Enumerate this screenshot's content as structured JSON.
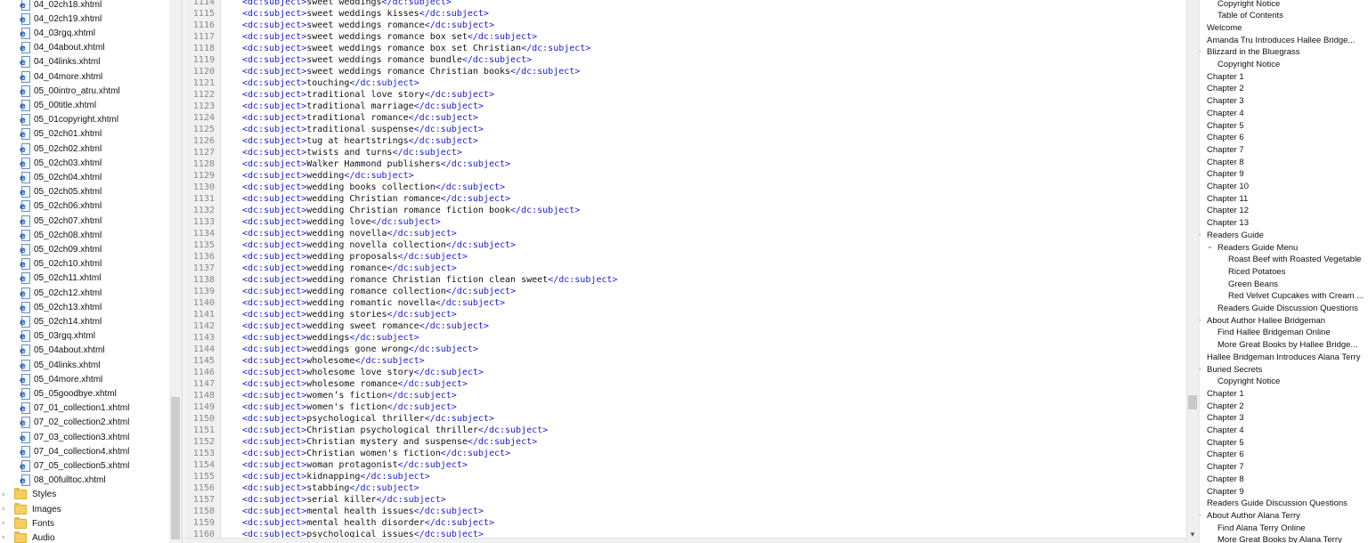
{
  "file_tree": {
    "files": [
      "04_02ch18.xhtml",
      "04_02ch19.xhtml",
      "04_03rgq.xhtml",
      "04_04about.xhtml",
      "04_04links.xhtml",
      "04_04more.xhtml",
      "05_00intro_atru.xhtml",
      "05_00title.xhtml",
      "05_01copyright.xhtml",
      "05_02ch01.xhtml",
      "05_02ch02.xhtml",
      "05_02ch03.xhtml",
      "05_02ch04.xhtml",
      "05_02ch05.xhtml",
      "05_02ch06.xhtml",
      "05_02ch07.xhtml",
      "05_02ch08.xhtml",
      "05_02ch09.xhtml",
      "05_02ch10.xhtml",
      "05_02ch11.xhtml",
      "05_02ch12.xhtml",
      "05_02ch13.xhtml",
      "05_02ch14.xhtml",
      "05_03rgq.xhtml",
      "05_04about.xhtml",
      "05_04links.xhtml",
      "05_04more.xhtml",
      "05_05goodbye.xhtml",
      "07_01_collection1.xhtml",
      "07_02_collection2.xhtml",
      "07_03_collection3.xhtml",
      "07_04_collection4.xhtml",
      "07_05_collection5.xhtml",
      "08_00fulltoc.xhtml"
    ],
    "folders": [
      "Styles",
      "Images",
      "Fonts",
      "Audio"
    ],
    "file_icon": "xhtml-file-icon",
    "folder_icon": "folder-icon"
  },
  "editor": {
    "tag_open": "<dc:subject>",
    "tag_close": "</dc:subject>",
    "lines": [
      {
        "n": "1114",
        "t": "sweet weddings"
      },
      {
        "n": "1115",
        "t": "sweet weddings kisses"
      },
      {
        "n": "1116",
        "t": "sweet weddings romance"
      },
      {
        "n": "1117",
        "t": "sweet weddings romance box set"
      },
      {
        "n": "1118",
        "t": "sweet weddings romance box set Christian"
      },
      {
        "n": "1119",
        "t": "sweet weddings romance bundle"
      },
      {
        "n": "1120",
        "t": "sweet weddings romance Christian books"
      },
      {
        "n": "1121",
        "t": "touching"
      },
      {
        "n": "1122",
        "t": "traditional love story"
      },
      {
        "n": "1123",
        "t": "traditional marriage"
      },
      {
        "n": "1124",
        "t": "traditional romance"
      },
      {
        "n": "1125",
        "t": "traditional suspense"
      },
      {
        "n": "1126",
        "t": "tug at heartstrings"
      },
      {
        "n": "1127",
        "t": "twists and turns"
      },
      {
        "n": "1128",
        "t": "Walker Hammond publishers"
      },
      {
        "n": "1129",
        "t": "wedding"
      },
      {
        "n": "1130",
        "t": "wedding books collection"
      },
      {
        "n": "1131",
        "t": "wedding Christian romance"
      },
      {
        "n": "1132",
        "t": "wedding Christian romance fiction book"
      },
      {
        "n": "1133",
        "t": "wedding love"
      },
      {
        "n": "1134",
        "t": "wedding novella"
      },
      {
        "n": "1135",
        "t": "wedding novella collection"
      },
      {
        "n": "1136",
        "t": "wedding proposals"
      },
      {
        "n": "1137",
        "t": "wedding romance"
      },
      {
        "n": "1138",
        "t": "wedding romance Christian fiction clean sweet"
      },
      {
        "n": "1139",
        "t": "wedding romance collection"
      },
      {
        "n": "1140",
        "t": "wedding romantic novella"
      },
      {
        "n": "1141",
        "t": "wedding stories"
      },
      {
        "n": "1142",
        "t": "wedding sweet romance"
      },
      {
        "n": "1143",
        "t": "weddings"
      },
      {
        "n": "1144",
        "t": "weddings gone wrong"
      },
      {
        "n": "1145",
        "t": "wholesome"
      },
      {
        "n": "1146",
        "t": "wholesome love story"
      },
      {
        "n": "1147",
        "t": "wholesome romance"
      },
      {
        "n": "1148",
        "t": "women’s fiction"
      },
      {
        "n": "1149",
        "t": "women's fiction"
      },
      {
        "n": "1150",
        "t": "psychological thriller"
      },
      {
        "n": "1151",
        "t": "Christian psychological thriller"
      },
      {
        "n": "1152",
        "t": "Christian mystery and suspense"
      },
      {
        "n": "1153",
        "t": "Christian women's fiction"
      },
      {
        "n": "1154",
        "t": "woman protagonist"
      },
      {
        "n": "1155",
        "t": "kidnapping"
      },
      {
        "n": "1156",
        "t": "stabbing"
      },
      {
        "n": "1157",
        "t": "serial killer"
      },
      {
        "n": "1158",
        "t": "mental health issues"
      },
      {
        "n": "1159",
        "t": "mental health disorder"
      },
      {
        "n": "1160",
        "t": "psychological issues"
      }
    ]
  },
  "toc": {
    "items": [
      {
        "text": "Copyright Notice",
        "level": 2,
        "chev": ""
      },
      {
        "text": "Table of Contents",
        "level": 2,
        "chev": ""
      },
      {
        "text": "Welcome",
        "level": 1,
        "chev": ""
      },
      {
        "text": "Amanda Tru Introduces Hallee Bridge...",
        "level": 1,
        "chev": ""
      },
      {
        "text": "Blizzard in the Bluegrass",
        "level": 1,
        "chev": "v"
      },
      {
        "text": "Copyright Notice",
        "level": 2,
        "chev": ""
      },
      {
        "text": "Chapter 1",
        "level": 1,
        "chev": ""
      },
      {
        "text": "Chapter 2",
        "level": 1,
        "chev": ""
      },
      {
        "text": "Chapter 3",
        "level": 1,
        "chev": ""
      },
      {
        "text": "Chapter 4",
        "level": 1,
        "chev": ""
      },
      {
        "text": "Chapter 5",
        "level": 1,
        "chev": ""
      },
      {
        "text": "Chapter 6",
        "level": 1,
        "chev": ""
      },
      {
        "text": "Chapter 7",
        "level": 1,
        "chev": ""
      },
      {
        "text": "Chapter 8",
        "level": 1,
        "chev": ""
      },
      {
        "text": "Chapter 9",
        "level": 1,
        "chev": ""
      },
      {
        "text": "Chapter 10",
        "level": 1,
        "chev": ""
      },
      {
        "text": "Chapter 11",
        "level": 1,
        "chev": ""
      },
      {
        "text": "Chapter 12",
        "level": 1,
        "chev": ""
      },
      {
        "text": "Chapter 13",
        "level": 1,
        "chev": ""
      },
      {
        "text": "Readers Guide",
        "level": 1,
        "chev": "v"
      },
      {
        "text": "Readers Guide Menu",
        "level": 2,
        "chev": "v"
      },
      {
        "text": "Roast Beef with Roasted Vegetable",
        "level": 3,
        "chev": ""
      },
      {
        "text": "Riced Potatoes",
        "level": 3,
        "chev": ""
      },
      {
        "text": "Green Beans",
        "level": 3,
        "chev": ""
      },
      {
        "text": "Red Velvet Cupcakes with Cream ...",
        "level": 3,
        "chev": ""
      },
      {
        "text": "Readers Guide Discussion Questions",
        "level": 2,
        "chev": ""
      },
      {
        "text": "About Author Hallee Bridgeman",
        "level": 1,
        "chev": "v"
      },
      {
        "text": "Find Hallee Bridgeman Online",
        "level": 2,
        "chev": ""
      },
      {
        "text": "More Great Books by Hallee Bridge...",
        "level": 2,
        "chev": ""
      },
      {
        "text": "Hallee Bridgeman Introduces Alana Terry",
        "level": 1,
        "chev": ""
      },
      {
        "text": "Buried Secrets",
        "level": 1,
        "chev": "v"
      },
      {
        "text": "Copyright Notice",
        "level": 2,
        "chev": ""
      },
      {
        "text": "Chapter 1",
        "level": 1,
        "chev": ""
      },
      {
        "text": "Chapter 2",
        "level": 1,
        "chev": ""
      },
      {
        "text": "Chapter 3",
        "level": 1,
        "chev": ""
      },
      {
        "text": "Chapter 4",
        "level": 1,
        "chev": ""
      },
      {
        "text": "Chapter 5",
        "level": 1,
        "chev": ""
      },
      {
        "text": "Chapter 6",
        "level": 1,
        "chev": ""
      },
      {
        "text": "Chapter 7",
        "level": 1,
        "chev": ""
      },
      {
        "text": "Chapter 8",
        "level": 1,
        "chev": ""
      },
      {
        "text": "Chapter 9",
        "level": 1,
        "chev": ""
      },
      {
        "text": "Readers Guide Discussion Questions",
        "level": 1,
        "chev": ""
      },
      {
        "text": "About Author Alana Terry",
        "level": 1,
        "chev": "v"
      },
      {
        "text": "Find Alana Terry Online",
        "level": 2,
        "chev": ""
      },
      {
        "text": "More Great Books by Alana Terry",
        "level": 2,
        "chev": ""
      }
    ]
  },
  "colors": {
    "tag": "#1c1ccc",
    "text": "#111111",
    "line_number": "#888888"
  }
}
